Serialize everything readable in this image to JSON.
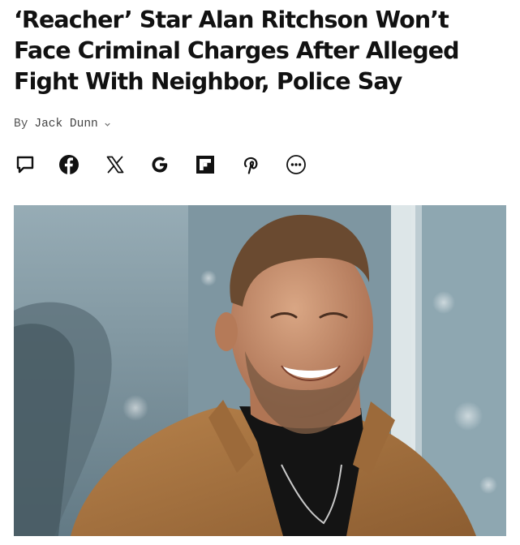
{
  "article": {
    "headline": "‘Reacher’ Star Alan Ritchson Won’t Face Criminal Charges After Alleged Fight With Neighbor, Police Say",
    "byline_prefix": "By",
    "author": "Jack Dunn"
  },
  "share_bar": {
    "items": [
      {
        "icon": "comment-icon"
      },
      {
        "icon": "facebook-icon"
      },
      {
        "icon": "x-icon"
      },
      {
        "icon": "google-icon"
      },
      {
        "icon": "flipboard-icon"
      },
      {
        "icon": "pinterest-icon"
      },
      {
        "icon": "more-icon"
      }
    ]
  },
  "hero_image": {
    "subject": "smiling man with short brown hair and beard in tan jacket over black shirt, blurred blue-grey backdrop"
  },
  "colors": {
    "text": "#111111",
    "byline": "#555555",
    "jacket": "#a9743f",
    "backdrop": "#7f97a2"
  }
}
